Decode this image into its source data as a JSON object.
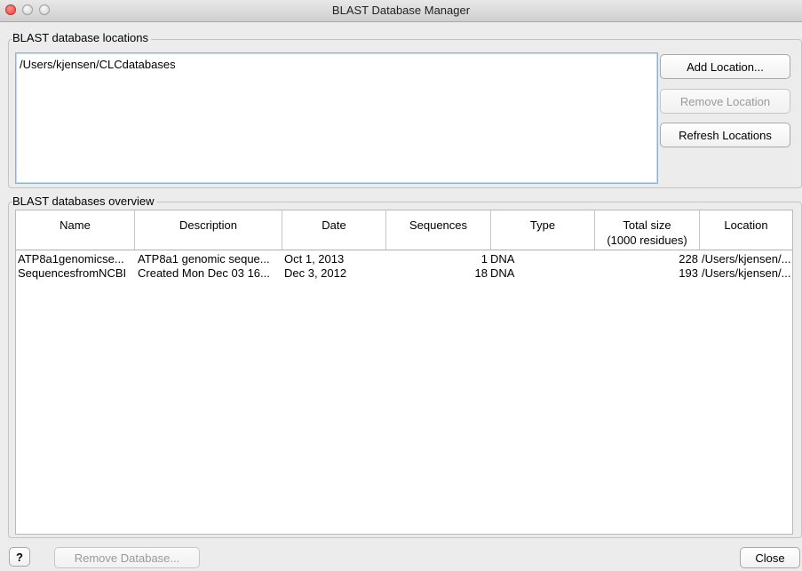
{
  "window": {
    "title": "BLAST Database Manager"
  },
  "locations_group": {
    "label": "BLAST database locations",
    "items": [
      "/Users/kjensen/CLCdatabases"
    ],
    "add_label": "Add Location...",
    "remove_label": "Remove Location",
    "refresh_label": "Refresh Locations"
  },
  "overview_group": {
    "label": "BLAST databases overview",
    "columns": [
      "Name",
      "Description",
      "Date",
      "Sequences",
      "Type",
      "Total size",
      "Location"
    ],
    "total_size_sub": "(1000 residues)",
    "rows": [
      {
        "name": "ATP8a1genomicse...",
        "description": "ATP8a1 genomic seque...",
        "date": "Oct 1, 2013",
        "sequences": "1",
        "type": "DNA",
        "total_size": "228",
        "location": "/Users/kjensen/..."
      },
      {
        "name": "SequencesfromNCBI",
        "description": "Created Mon Dec 03 16...",
        "date": "Dec 3, 2012",
        "sequences": "18",
        "type": "DNA",
        "total_size": "193",
        "location": "/Users/kjensen/..."
      }
    ]
  },
  "footer": {
    "help_label": "?",
    "remove_db_label": "Remove Database...",
    "close_label": "Close"
  }
}
